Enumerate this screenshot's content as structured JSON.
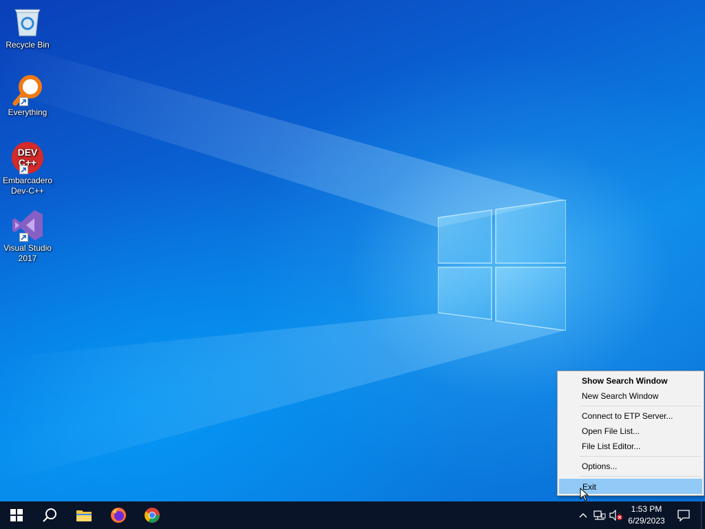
{
  "desktop": {
    "icons": [
      {
        "label": "Recycle Bin",
        "icon": "recycle-bin-icon"
      },
      {
        "label": "Everything",
        "icon": "everything-magnifier-icon"
      },
      {
        "label": "Embarcadero Dev-C++",
        "icon": "devcpp-icon",
        "badge_top": "DEV",
        "badge_bottom": "C++"
      },
      {
        "label": "Visual Studio 2017",
        "icon": "visual-studio-icon"
      }
    ]
  },
  "context_menu": {
    "items": [
      {
        "label": "Show Search Window",
        "bold": true
      },
      {
        "label": "New Search Window"
      },
      {
        "label": "Connect to ETP Server..."
      },
      {
        "label": "Open File List..."
      },
      {
        "label": "File List Editor..."
      },
      {
        "label": "Options..."
      },
      {
        "label": "Exit",
        "highlighted": true
      }
    ],
    "highlight_color": "#91c9f7"
  },
  "taskbar": {
    "pinned": [
      "windows-start-icon",
      "search-icon",
      "file-explorer-icon",
      "firefox-icon",
      "chrome-icon"
    ],
    "tray": {
      "icons": [
        "chevron-up-icon",
        "network-icon",
        "volume-muted-icon",
        "notification-icon"
      ],
      "time": "1:53 PM",
      "date": "6/29/2023"
    },
    "background": "#0a1428"
  }
}
